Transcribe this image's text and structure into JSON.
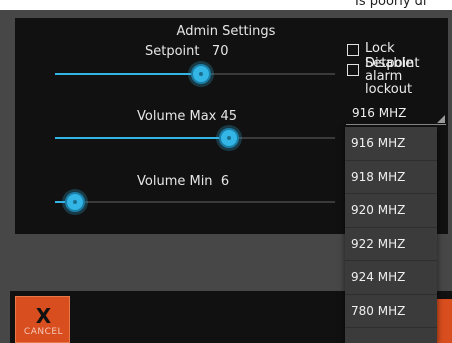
{
  "status_fragment": "Is poorly di",
  "dialog": {
    "title": "Admin Settings",
    "sliders": [
      {
        "label": "Setpoint",
        "value": "70",
        "level": 0.52
      },
      {
        "label": "Volume Max",
        "value": "45",
        "level": 0.62
      },
      {
        "label": "Volume Min",
        "value": "6",
        "level": 0.07
      }
    ],
    "checkboxes": [
      {
        "label": "Lock Setpoint",
        "checked": false
      },
      {
        "label": "Disable alarm lockout",
        "checked": false
      }
    ],
    "frequency": {
      "selected": "916 MHZ",
      "options": [
        "916 MHZ",
        "918 MHZ",
        "920 MHZ",
        "922 MHZ",
        "924 MHZ",
        "780 MHZ"
      ]
    }
  },
  "buttons": {
    "cancel_icon": "X",
    "cancel_label": "CANCEL"
  },
  "colors": {
    "accent": "#33b5e5",
    "cancel": "#d94e1f",
    "dialog_bg": "#111111"
  }
}
